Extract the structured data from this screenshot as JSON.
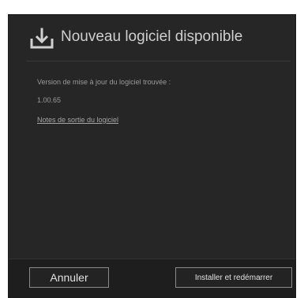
{
  "dialog": {
    "title": "Nouveau logiciel disponible",
    "icon": "download-icon",
    "version_label": "Version de mise à jour du logiciel trouvée :",
    "version_value": "1.00.65",
    "release_notes_link": "Notes de sortie du logiciel"
  },
  "footer": {
    "cancel_label": "Annuler",
    "install_label": "Installer et redémarrer"
  },
  "colors": {
    "dialog_background": "#262626",
    "footer_background": "#1e1e1e",
    "text_muted": "#9a9a9a",
    "title_text": "#cfcfcf",
    "button_border": "#8a8a8a"
  }
}
